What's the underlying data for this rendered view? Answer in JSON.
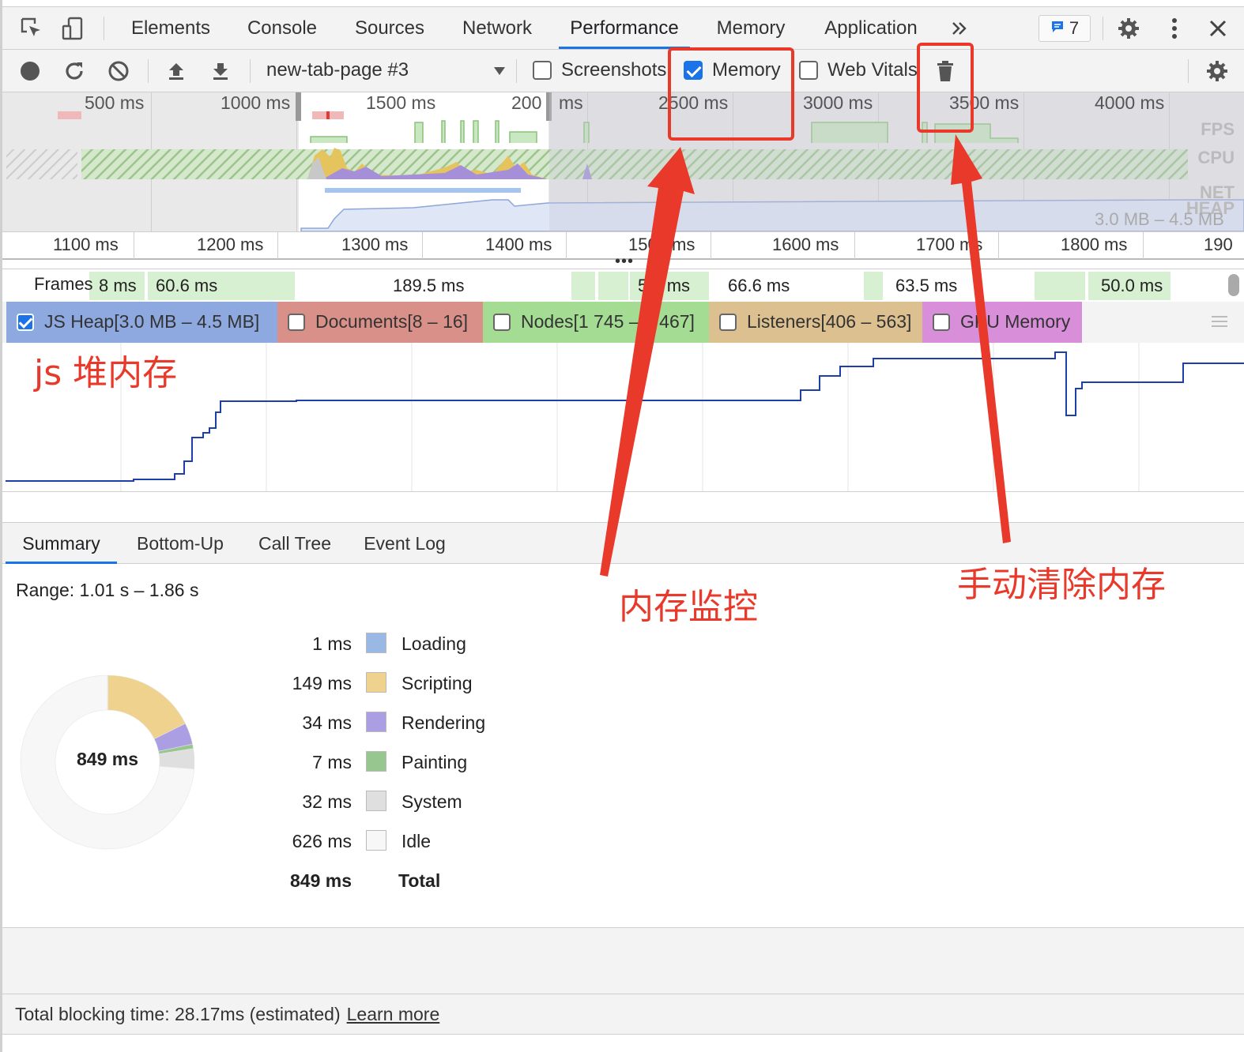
{
  "main_tabs": [
    {
      "label": "Elements",
      "active": false
    },
    {
      "label": "Console",
      "active": false
    },
    {
      "label": "Sources",
      "active": false
    },
    {
      "label": "Network",
      "active": false
    },
    {
      "label": "Performance",
      "active": true
    },
    {
      "label": "Memory",
      "active": false
    },
    {
      "label": "Application",
      "active": false
    }
  ],
  "tabbar": {
    "more_tabs_icon": "double-chevron-right-icon",
    "issues_count": "7",
    "icons": [
      "inspect-element-icon",
      "device-toolbar-icon",
      "issues-icon",
      "settings-gear-icon",
      "kebab-menu-icon",
      "close-icon"
    ]
  },
  "toolbar": {
    "target": "new-tab-page #3",
    "icons": [
      "record-icon",
      "reload-icon",
      "clear-icon",
      "upload-icon",
      "download-icon",
      "dropdown-arrow-icon",
      "trash-icon",
      "settings-gear-icon"
    ],
    "checkboxes": [
      {
        "label": "Screenshots",
        "checked": false
      },
      {
        "label": "Memory",
        "checked": true
      },
      {
        "label": "Web Vitals",
        "checked": false
      }
    ]
  },
  "overview": {
    "ticks": [
      "500 ms",
      "1000 ms",
      "1500 ms",
      "200",
      "ms",
      "2500 ms",
      "3000 ms",
      "3500 ms",
      "4000 ms"
    ],
    "track_labels": [
      "FPS",
      "CPU",
      "NET",
      "HEAP"
    ],
    "heap_range": "3.0 MB – 4.5 MB"
  },
  "ruler": {
    "ticks": [
      "1100 ms",
      "1200 ms",
      "1300 ms",
      "1400 ms",
      "1500 ms",
      "1600 ms",
      "1700 ms",
      "1800 ms",
      "190"
    ]
  },
  "frames": {
    "label": "Frames",
    "durations": [
      "8 ms",
      "60.6 ms",
      "189.5 ms",
      "5.2 ms",
      "66.6 ms",
      "63.5 ms",
      "50.0 ms"
    ]
  },
  "counters": [
    {
      "label": "JS Heap[3.0 MB – 4.5 MB]",
      "checked": true,
      "color": "#8ea8e0"
    },
    {
      "label": "Documents[8 – 16]",
      "checked": false,
      "color": "#d99088"
    },
    {
      "label": "Nodes[1 745 – 2 467]",
      "checked": false,
      "color": "#a4dc94"
    },
    {
      "label": "Listeners[406 – 563]",
      "checked": false,
      "color": "#dcc08f"
    },
    {
      "label": "GPU Memory",
      "checked": false,
      "color": "#d88ed8"
    }
  ],
  "counters_menu_icon": "hamburger-menu-icon",
  "heap_line_color": "#1f3fa8",
  "bottom_tabs": [
    {
      "label": "Summary",
      "active": true
    },
    {
      "label": "Bottom-Up",
      "active": false
    },
    {
      "label": "Call Tree",
      "active": false
    },
    {
      "label": "Event Log",
      "active": false
    }
  ],
  "summary": {
    "range": "Range: 1.01 s – 1.86 s",
    "total_center": "849 ms",
    "rows": [
      {
        "value": "1 ms",
        "category": "Loading",
        "color": "#9ab8e4"
      },
      {
        "value": "149 ms",
        "category": "Scripting",
        "color": "#eed28e"
      },
      {
        "value": "34 ms",
        "category": "Rendering",
        "color": "#ab9ee2"
      },
      {
        "value": "7 ms",
        "category": "Painting",
        "color": "#97c68f"
      },
      {
        "value": "32 ms",
        "category": "System",
        "color": "#dfdfdf"
      },
      {
        "value": "626 ms",
        "category": "Idle",
        "color": "#f7f7f7"
      }
    ],
    "total": {
      "value": "849 ms",
      "category": "Total"
    }
  },
  "footer": {
    "text": "Total blocking time: 28.17ms (estimated)",
    "link": "Learn more"
  },
  "annotations": {
    "js_heap": "js 堆内存",
    "memory_monitor": "内存监控",
    "manual_gc": "手动清除内存",
    "color": "#e8392a"
  }
}
